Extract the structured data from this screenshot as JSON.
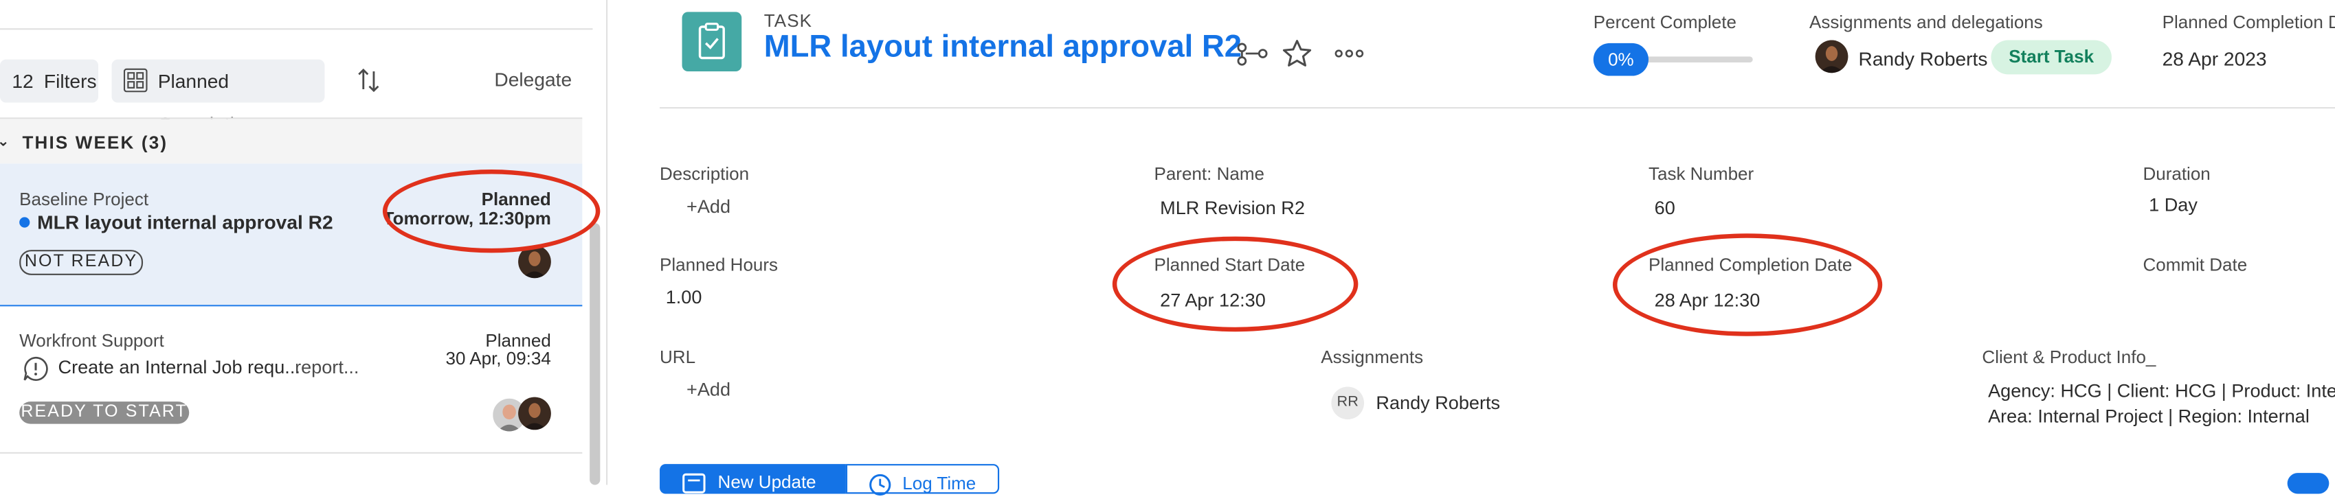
{
  "list_toolbar": {
    "filters_count": "12",
    "filters_label": "Filters",
    "planned_completion_label": "Planned Completion",
    "delegate_label": "Delegate"
  },
  "week_section": {
    "title": "THIS WEEK (3)"
  },
  "task_cards": [
    {
      "project": "Baseline Project",
      "title": "MLR layout internal approval R2",
      "date_label": "Planned",
      "date_value": "Tomorrow, 12:30pm",
      "status": "NOT READY"
    },
    {
      "project": "Workfront Support",
      "title": "Create an Internal Job requ...",
      "title_suffix": "report...",
      "date_label": "Planned",
      "date_value": "30 Apr, 09:34",
      "status": "READY TO START"
    }
  ],
  "header": {
    "task_type": "TASK",
    "task_title": "MLR layout internal approval R2",
    "percent_complete_label": "Percent Complete",
    "percent_complete_value": "0%",
    "percent_complete_fraction": 0,
    "assignments_label": "Assignments and delegations",
    "assignee": "Randy Roberts",
    "start_task_label": "Start Task",
    "planned_completion_label": "Planned Completion D",
    "planned_completion_value": "28 Apr 2023"
  },
  "details": {
    "description_label": "Description",
    "description_add": "+Add",
    "parent_name_label": "Parent: Name",
    "parent_name_value": "MLR Revision R2",
    "task_number_label": "Task Number",
    "task_number_value": "60",
    "duration_label": "Duration",
    "duration_value": "1 Day",
    "planned_hours_label": "Planned Hours",
    "planned_hours_value": "1.00",
    "planned_start_label": "Planned Start Date",
    "planned_start_value": "27 Apr 12:30",
    "planned_completion_date_label": "Planned Completion Date",
    "planned_completion_date_value": "28 Apr 12:30",
    "commit_date_label": "Commit Date",
    "url_label": "URL",
    "url_add": "+Add",
    "assignments_label": "Assignments",
    "assignee_initials": "RR",
    "assignee_name": "Randy Roberts",
    "client_info_label": "Client & Product Info_",
    "client_info_line1": "Agency: HCG | Client: HCG | Product: Interco",
    "client_info_line2": "Area: Internal Project | Region: Internal"
  },
  "actions": {
    "new_update_label": "New Update",
    "log_time_label": "Log Time"
  },
  "colors": {
    "accent": "#1473e6",
    "annotation": "#e0311c",
    "task_icon": "#45a9a5",
    "start_task_bg": "#d7f3e2"
  }
}
